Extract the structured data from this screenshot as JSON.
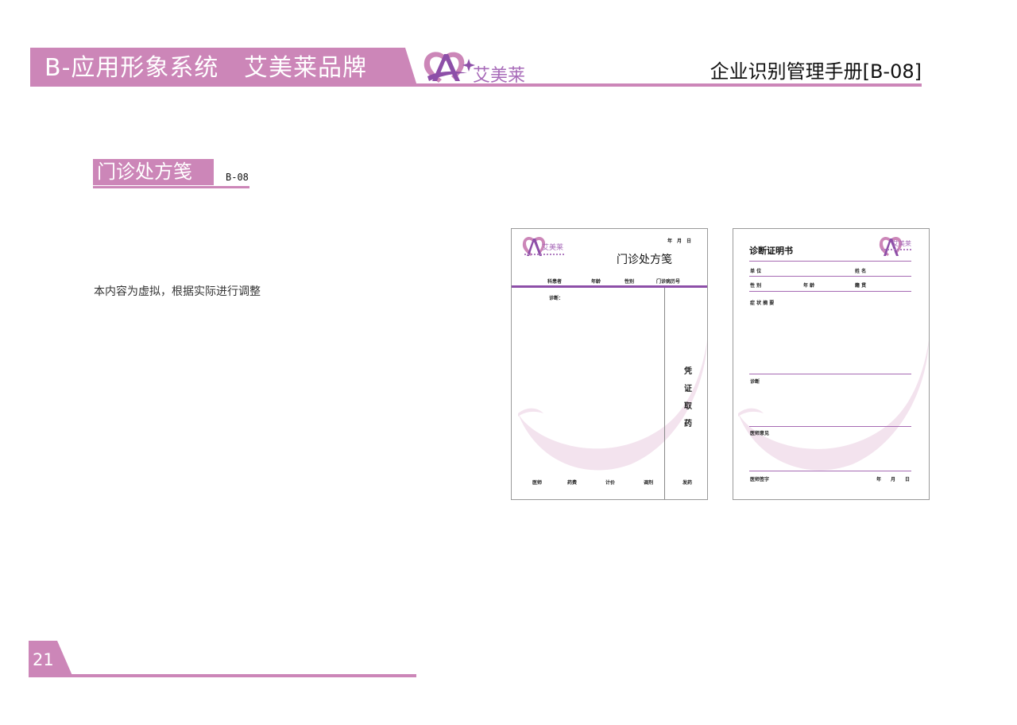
{
  "header": {
    "title": "B-应用形象系统   艾美莱品牌",
    "brand": "艾美莱",
    "manual": "企业识别管理手册[B-08]"
  },
  "section": {
    "title": "门诊处方笺",
    "code": "B-08",
    "description": "本内容为虚拟，根据实际进行调整"
  },
  "footer": {
    "page": "21"
  },
  "colors": {
    "accent": "#cc86b8",
    "logo": "#a76ab8",
    "line": "#a66ab3"
  },
  "prescription": {
    "brand": "艾美莱",
    "date": "年　月　日",
    "title": "门诊处方笺",
    "fields": [
      "科患者",
      "年龄",
      "性别",
      "门诊病历号"
    ],
    "diagnosis": "诊断：",
    "side_chars": [
      "凭",
      "证",
      "取",
      "药"
    ],
    "bottom": [
      "医师",
      "药费",
      "计价",
      "调剂"
    ],
    "dispense": "发药"
  },
  "certificate": {
    "title": "诊断证明书",
    "brand": "艾美莱",
    "unit": "单  位",
    "name": "姓  名",
    "gender": "性  别",
    "age": "年  龄",
    "origin": "籍  贯",
    "symptoms": "症  状  摘  要",
    "diagnosis": "诊断",
    "opinion": "医师意见",
    "signature": "医师签字",
    "date": "年　　月　　日"
  }
}
